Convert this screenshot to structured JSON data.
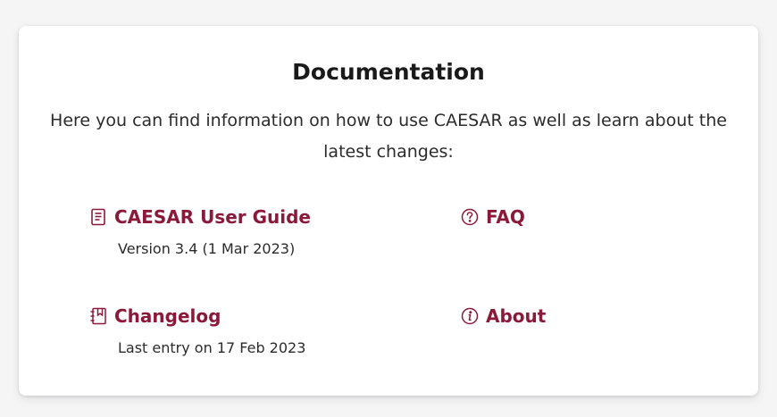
{
  "accent_color": "#8b1a3a",
  "card": {
    "title": "Documentation",
    "intro": "Here you can find information on how to use CAESAR as well as learn about the latest changes:"
  },
  "links": {
    "user_guide": {
      "label": "CAESAR User Guide",
      "subtitle": "Version 3.4 (1 Mar 2023)",
      "icon": "document-icon"
    },
    "faq": {
      "label": "FAQ",
      "icon": "question-circle-icon"
    },
    "changelog": {
      "label": "Changelog",
      "subtitle": "Last entry on 17 Feb 2023",
      "icon": "notebook-icon"
    },
    "about": {
      "label": "About",
      "icon": "info-circle-icon"
    }
  }
}
